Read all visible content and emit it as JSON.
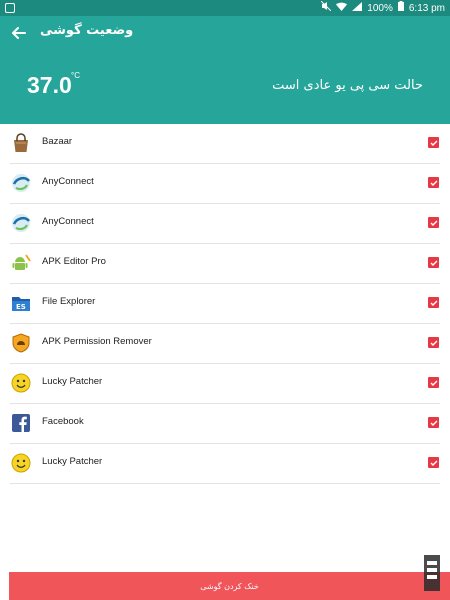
{
  "status_bar": {
    "battery_text": "100%",
    "time": "6:13 pm"
  },
  "header": {
    "title": "وضعیت گوشی",
    "temperature": "37.0",
    "temperature_unit": "°C",
    "status_text": "حالت سی پی یو عادی است",
    "background_color": "#26a69a"
  },
  "apps": [
    {
      "name": "Bazaar",
      "icon": "bazaar-bag-icon",
      "checked": true
    },
    {
      "name": "AnyConnect",
      "icon": "anyconnect-globe-icon",
      "checked": true
    },
    {
      "name": "AnyConnect",
      "icon": "anyconnect-globe-icon",
      "checked": true
    },
    {
      "name": "APK Editor Pro",
      "icon": "android-robot-icon",
      "checked": true
    },
    {
      "name": "File Explorer",
      "icon": "folder-icon",
      "checked": true
    },
    {
      "name": "APK Permission Remover",
      "icon": "shield-icon",
      "checked": true
    },
    {
      "name": "Lucky Patcher",
      "icon": "smiley-icon",
      "checked": true
    },
    {
      "name": "Facebook",
      "icon": "facebook-icon",
      "checked": true
    },
    {
      "name": "Lucky Patcher",
      "icon": "smiley-icon",
      "checked": true
    }
  ],
  "action_button": {
    "label": "خنک کردن گوشی",
    "color": "#f0555a"
  },
  "checkbox_color": "#e53945"
}
